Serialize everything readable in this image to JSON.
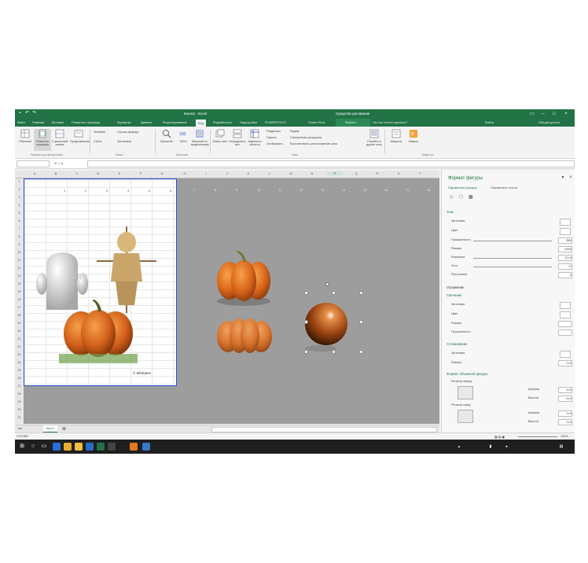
{
  "window": {
    "title": "Книга1 - Excel",
    "context_group": "Средства рисования",
    "context_tab": "Формат",
    "tell_me": "Что вы хотите сделать?",
    "account": "Войти",
    "share": "Общий доступ"
  },
  "tabs": [
    "Файл",
    "Главная",
    "Вставка",
    "Разметка страницы",
    "Формулы",
    "Данные",
    "Рецензирование",
    "Вид",
    "Разработчик",
    "Надстройки",
    "POWERPIVOT",
    "Power Pivot",
    "Формат"
  ],
  "active_tab": "Вид",
  "ribbon": {
    "buttons": [
      {
        "label": "Обычный"
      },
      {
        "label": "Разметка страницы"
      },
      {
        "label": "Страничный режим"
      },
      {
        "label": "Представления"
      },
      {
        "label": "Масштаб"
      },
      {
        "label": "100%"
      },
      {
        "label": "Масштаб по выделенному"
      },
      {
        "label": "Новое окно"
      },
      {
        "label": "Упорядочить все"
      },
      {
        "label": "Закрепить области"
      },
      {
        "label": "Перейти в другое окно"
      },
      {
        "label": "Макросы"
      },
      {
        "label": "Макрос"
      }
    ],
    "small": [
      "Линейка",
      "Строка формул",
      "Сетка",
      "Заголовки",
      "Разделить",
      "Скрыть",
      "Отобразить",
      "Рядом",
      "Синхронная прокрутка",
      "Восстановить расположение окна"
    ],
    "groups": [
      "Режимы просмотра книги",
      "Показ",
      "Масштаб",
      "Окно",
      "Макросы"
    ]
  },
  "formula_bar": {
    "name_box": "",
    "value": ""
  },
  "columns": [
    "A",
    "B",
    "C",
    "D",
    "E",
    "F",
    "G",
    "H",
    "I",
    "J",
    "K",
    "L",
    "M",
    "N",
    "O",
    "P",
    "Q",
    "R",
    "S",
    "T"
  ],
  "selected_column": "P",
  "rows": [
    "1",
    "2",
    "3",
    "4",
    "5",
    "6",
    "7",
    "8",
    "9",
    "10",
    "11",
    "12",
    "13",
    "14",
    "15",
    "16",
    "17",
    "18",
    "19",
    "20",
    "21",
    "22",
    "23",
    "24",
    "25",
    "26",
    "27",
    "28",
    "29",
    "30",
    "31"
  ],
  "page_numbers": [
    "1",
    "2",
    "3",
    "4",
    "5",
    "6",
    "7",
    "8",
    "9",
    "10",
    "11",
    "12",
    "13",
    "14",
    "15",
    "16",
    "17",
    "18"
  ],
  "watermark": "Стра",
  "caption": "© Mihbates",
  "sheet_tab": "Лист1",
  "status": {
    "left": "ГОТОВО",
    "zoom": "100%"
  },
  "pane": {
    "title": "Формат фигуры",
    "tab1": "Параметры фигуры",
    "tab2": "Параметры текста",
    "shadow_header": "Тень",
    "shadow_rows": [
      {
        "label": "Заготовки",
        "value": ""
      },
      {
        "label": "Цвет",
        "value": ""
      },
      {
        "label": "Прозрачность",
        "value": "28%"
      },
      {
        "label": "Размер",
        "value": "100%"
      },
      {
        "label": "Размытие",
        "value": "12 пт"
      },
      {
        "label": "Угол",
        "value": "0°"
      },
      {
        "label": "Расстояние",
        "value": "0"
      }
    ],
    "reflection_header": "Отражение",
    "glow_header": "Свечение",
    "glow_rows": [
      {
        "label": "Заготовки",
        "value": ""
      },
      {
        "label": "Цвет",
        "value": ""
      },
      {
        "label": "Размер",
        "value": ""
      },
      {
        "label": "Прозрачность",
        "value": ""
      }
    ],
    "soft_header": "Сглаживание",
    "soft_rows": [
      {
        "label": "Заготовки",
        "value": ""
      },
      {
        "label": "Размер",
        "value": "0 пт"
      }
    ],
    "bevel_header": "Формат объемной фигуры",
    "bevel_top": "Рельеф сверху",
    "bevel_bottom": "Рельеф снизу",
    "bevel_fields": [
      {
        "label": "Ширина",
        "value": "6 пт"
      },
      {
        "label": "Высота",
        "value": "6 пт"
      },
      {
        "label": "Ширина",
        "value": "0 пт"
      },
      {
        "label": "Высота",
        "value": "0 пт"
      }
    ]
  },
  "colors": {
    "excel_green": "#217346",
    "pumpkin": "#e07a1f",
    "canvas_gray": "#9d9d9d",
    "page_border": "#2b4fd8"
  }
}
